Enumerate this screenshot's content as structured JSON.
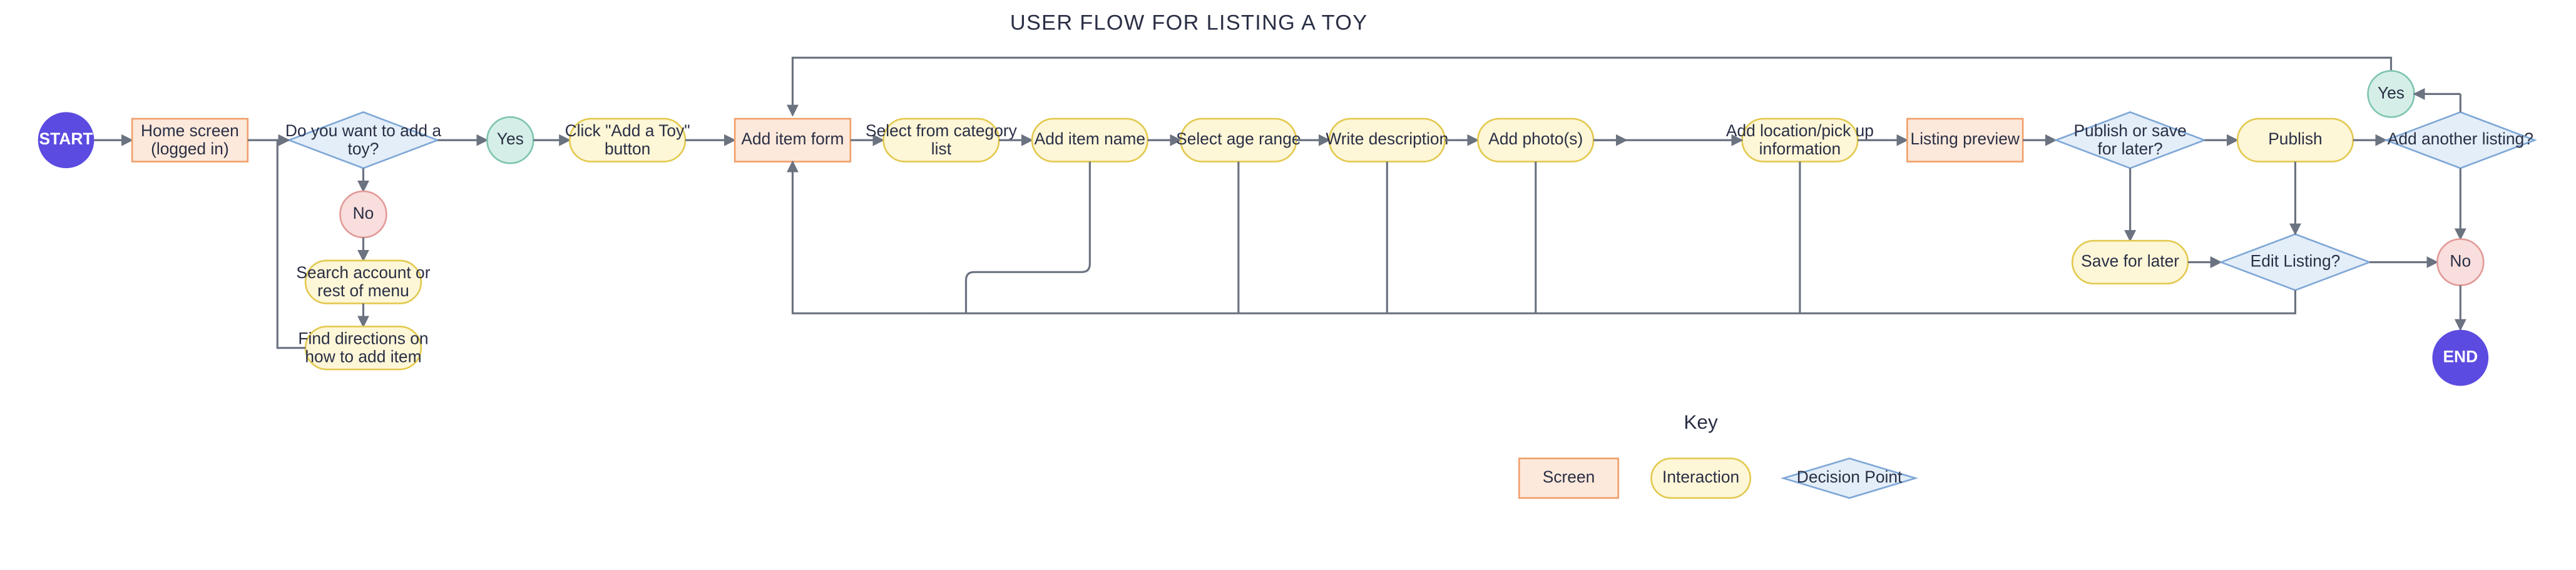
{
  "title": "USER FLOW FOR LISTING A TOY",
  "nodes": {
    "start": "START",
    "end": "END",
    "home": [
      "Home screen",
      "(logged in)"
    ],
    "wantAdd": [
      "Do you want to add a",
      "toy?"
    ],
    "yes1": "Yes",
    "no1": "No",
    "search": [
      "Search account or",
      "rest of menu"
    ],
    "findDir": [
      "Find directions on",
      "how to add item"
    ],
    "clickAdd": [
      "Click \"Add a Toy\"",
      "button"
    ],
    "addForm": "Add item form",
    "selectCat": [
      "Select from category",
      "list"
    ],
    "addName": "Add item name",
    "ageRange": "Select age range",
    "writeDesc": "Write description",
    "addPhotos": "Add photo(s)",
    "addLoc": [
      "Add location/pick up",
      "information"
    ],
    "listingPrev": "Listing preview",
    "pubOrSave": [
      "Publish or save",
      "for later?"
    ],
    "publish": "Publish",
    "saveLater": "Save for later",
    "editListing": "Edit Listing?",
    "addAnother": "Add another listing?",
    "yes2": "Yes",
    "no2": "No"
  },
  "key": {
    "title": "Key",
    "screen": "Screen",
    "interaction": "Interaction",
    "decision": "Decision Point"
  },
  "colors": {
    "purple": "#5b4be0",
    "screenFill": "#fde9db",
    "screenStroke": "#f1a06b",
    "interFill": "#fdf6d7",
    "interStroke": "#e3c94f",
    "decFill": "#e4eef8",
    "decStroke": "#7ea7d6",
    "yesFill": "#d5efe8",
    "yesStroke": "#7fc4b0",
    "noFill": "#f8dedd",
    "noStroke": "#e29a98",
    "arrow": "#6b7280"
  }
}
